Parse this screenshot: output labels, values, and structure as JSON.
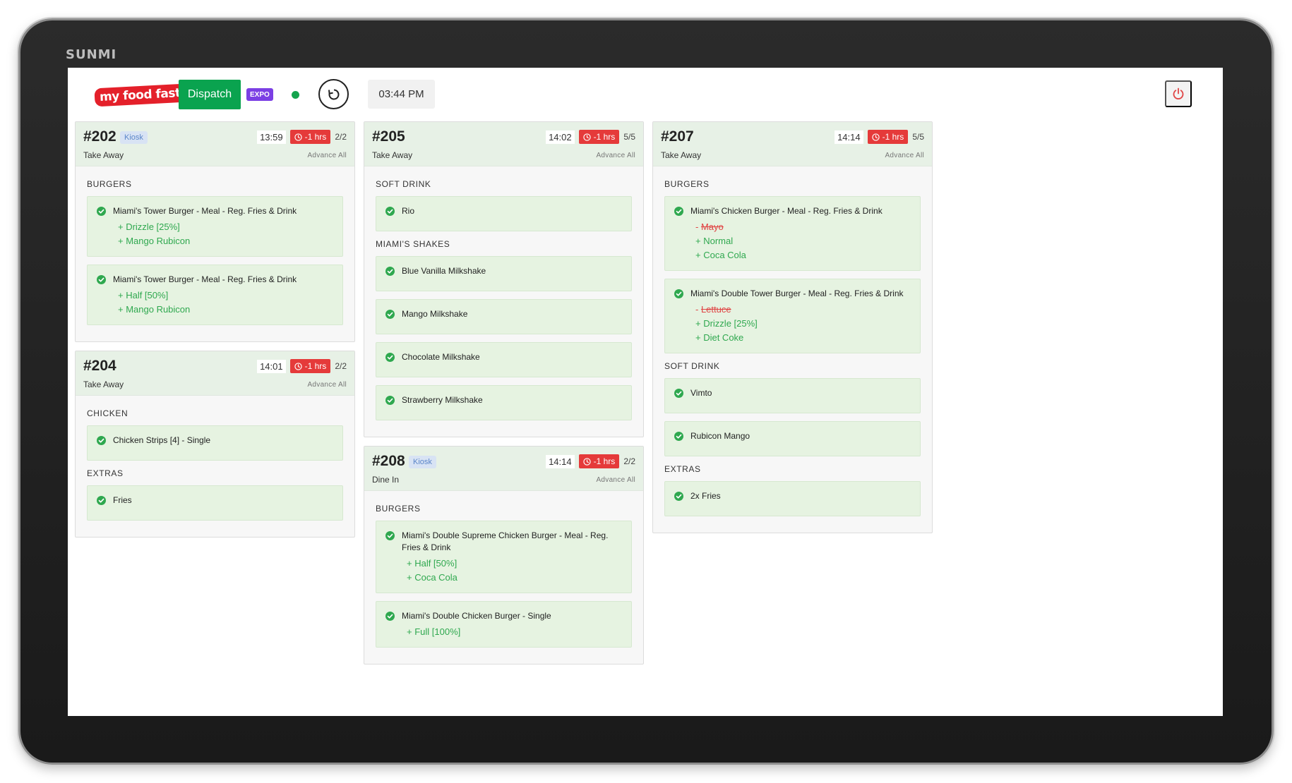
{
  "device": {
    "brand": "SUNMI"
  },
  "topbar": {
    "logo": "my food fast",
    "dispatch_label": "Dispatch",
    "expo_label": "EXPO",
    "clock": "03:44 PM",
    "status_color": "#14a44d"
  },
  "colors": {
    "accent": "#0aa34f",
    "late": "#e53a3a",
    "addon": "#2fa84f",
    "removed": "#e04545",
    "expo": "#7b3fe4"
  },
  "orders": [
    {
      "number": "#202",
      "source": "Kiosk",
      "type": "Take Away",
      "time": "13:59",
      "late": "-1 hrs",
      "count": "2/2",
      "advance": "Advance All",
      "groups": [
        {
          "title": "BURGERS",
          "items": [
            {
              "name": "Miami's Tower Burger - Meal - Reg. Fries & Drink",
              "mods": [
                {
                  "text": "+ Drizzle [25%]",
                  "kind": "add"
                },
                {
                  "text": "+ Mango Rubicon",
                  "kind": "add"
                }
              ]
            },
            {
              "name": "Miami's Tower Burger - Meal - Reg. Fries & Drink",
              "mods": [
                {
                  "text": "+ Half [50%]",
                  "kind": "add"
                },
                {
                  "text": "+ Mango Rubicon",
                  "kind": "add"
                }
              ]
            }
          ]
        }
      ]
    },
    {
      "number": "#204",
      "source": "",
      "type": "Take Away",
      "time": "14:01",
      "late": "-1 hrs",
      "count": "2/2",
      "advance": "Advance All",
      "groups": [
        {
          "title": "CHICKEN",
          "items": [
            {
              "name": "Chicken Strips [4] - Single",
              "mods": []
            }
          ]
        },
        {
          "title": "EXTRAS",
          "items": [
            {
              "name": "Fries",
              "mods": []
            }
          ]
        }
      ]
    },
    {
      "number": "#205",
      "source": "",
      "type": "Take Away",
      "time": "14:02",
      "late": "-1 hrs",
      "count": "5/5",
      "advance": "Advance All",
      "groups": [
        {
          "title": "SOFT DRINK",
          "items": [
            {
              "name": "Rio",
              "mods": []
            }
          ]
        },
        {
          "title": "MIAMI'S SHAKES",
          "items": [
            {
              "name": "Blue Vanilla Milkshake",
              "mods": []
            },
            {
              "name": "Mango Milkshake",
              "mods": []
            },
            {
              "name": "Chocolate Milkshake",
              "mods": []
            },
            {
              "name": "Strawberry Milkshake",
              "mods": []
            }
          ]
        }
      ]
    },
    {
      "number": "#208",
      "source": "Kiosk",
      "type": "Dine In",
      "time": "14:14",
      "late": "-1 hrs",
      "count": "2/2",
      "advance": "Advance All",
      "groups": [
        {
          "title": "BURGERS",
          "items": [
            {
              "name": "Miami's Double Supreme Chicken Burger - Meal - Reg. Fries & Drink",
              "mods": [
                {
                  "text": "+ Half [50%]",
                  "kind": "add"
                },
                {
                  "text": "+ Coca Cola",
                  "kind": "add"
                }
              ]
            },
            {
              "name": "Miami's Double Chicken Burger - Single",
              "mods": [
                {
                  "text": "+ Full [100%]",
                  "kind": "add"
                }
              ]
            }
          ]
        }
      ]
    },
    {
      "number": "#207",
      "source": "",
      "type": "Take Away",
      "time": "14:14",
      "late": "-1 hrs",
      "count": "5/5",
      "advance": "Advance All",
      "groups": [
        {
          "title": "BURGERS",
          "items": [
            {
              "name": "Miami's Chicken Burger - Meal - Reg. Fries & Drink",
              "mods": [
                {
                  "text": "Mayo",
                  "kind": "remove"
                },
                {
                  "text": "+ Normal",
                  "kind": "add"
                },
                {
                  "text": "+ Coca Cola",
                  "kind": "add"
                }
              ]
            },
            {
              "name": "Miami's Double Tower Burger - Meal - Reg. Fries & Drink",
              "mods": [
                {
                  "text": "Lettuce",
                  "kind": "remove"
                },
                {
                  "text": "+ Drizzle [25%]",
                  "kind": "add"
                },
                {
                  "text": "+ Diet Coke",
                  "kind": "add"
                }
              ]
            }
          ]
        },
        {
          "title": "SOFT DRINK",
          "items": [
            {
              "name": "Vimto",
              "mods": []
            },
            {
              "name": "Rubicon Mango",
              "mods": []
            }
          ]
        },
        {
          "title": "EXTRAS",
          "items": [
            {
              "name": "2x Fries",
              "mods": []
            }
          ]
        }
      ]
    }
  ]
}
